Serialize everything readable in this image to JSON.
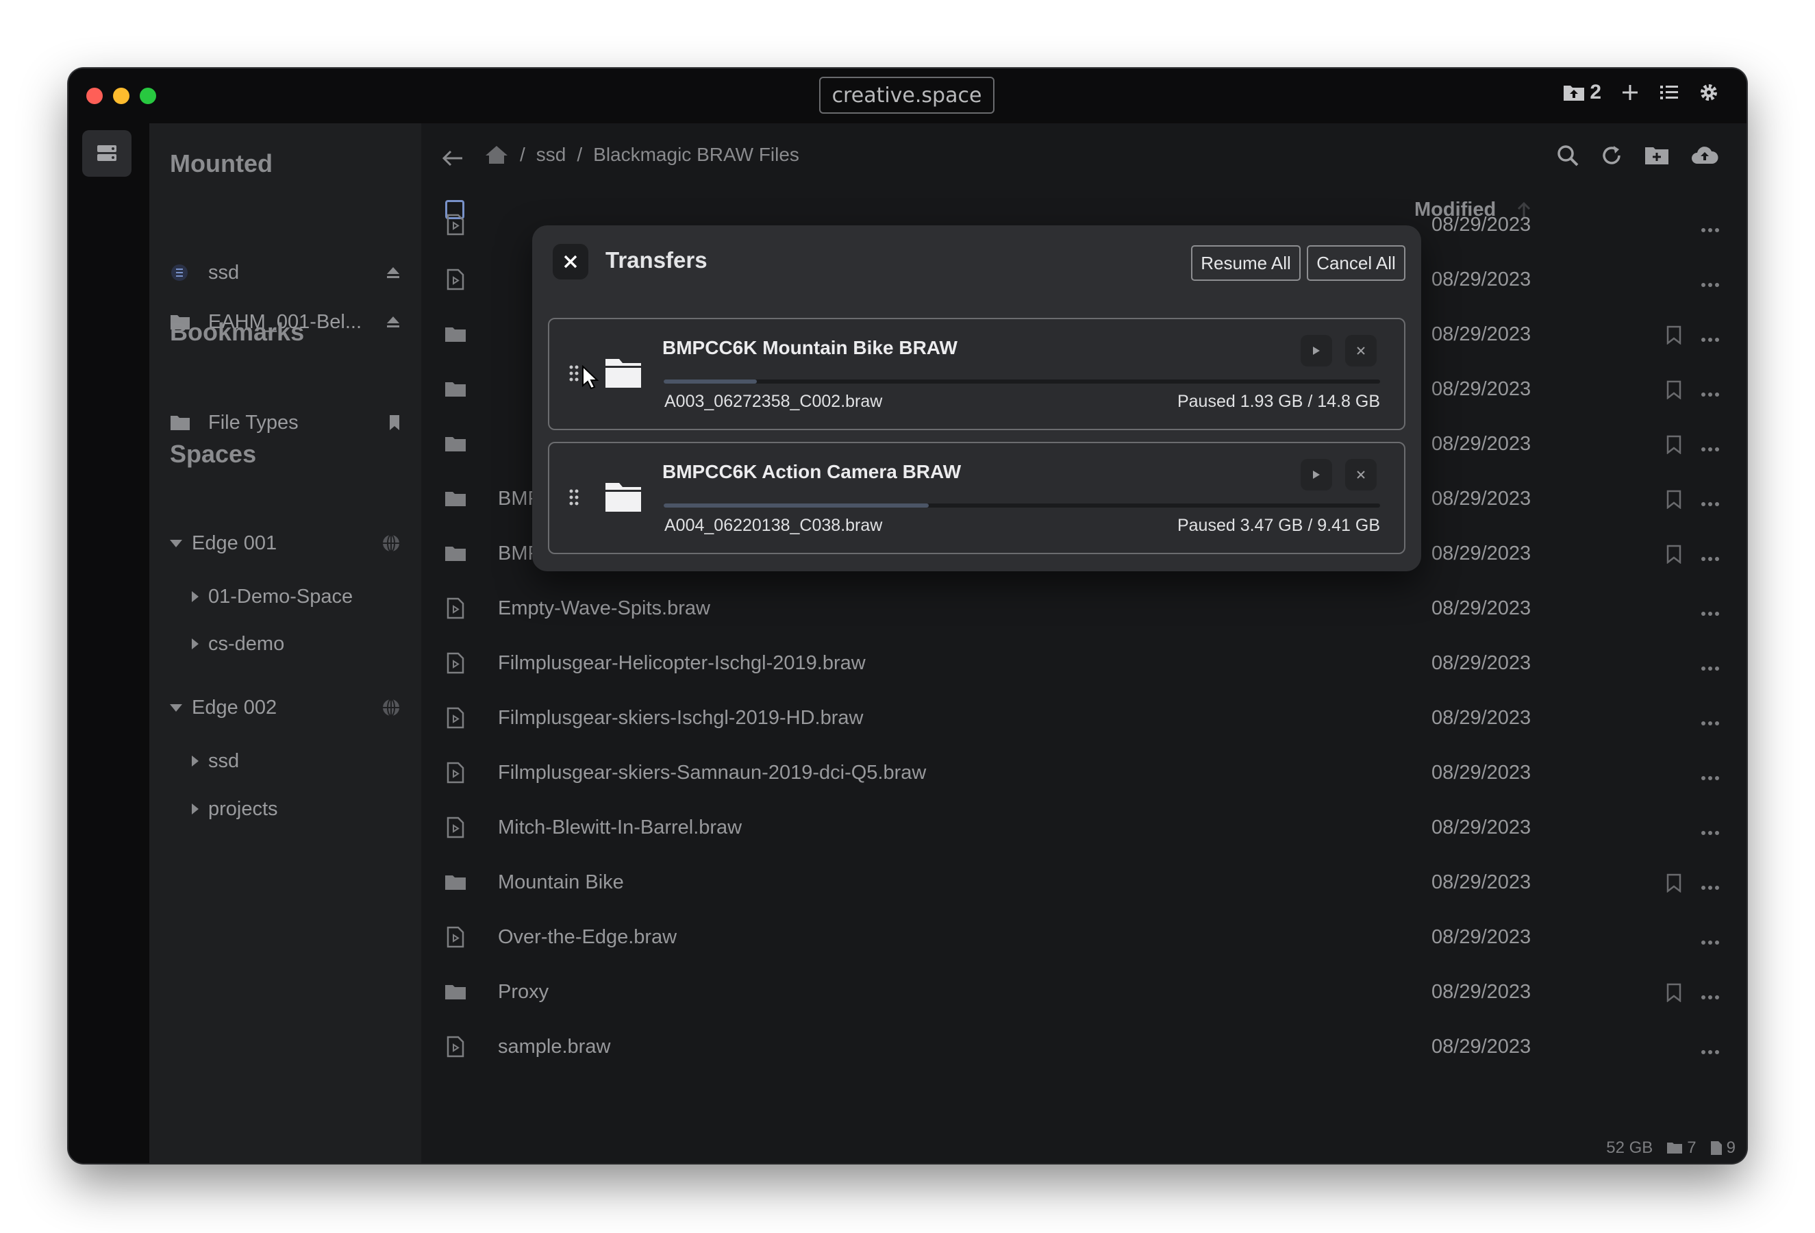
{
  "window": {
    "title": "creative.space"
  },
  "toolbar": {
    "badge_count": "2"
  },
  "sidebar": {
    "mounted_title": "Mounted",
    "mounted": [
      {
        "label": "ssd",
        "icon": "drive-icon"
      },
      {
        "label": "EAHM_001-Bel...",
        "icon": "folder-icon"
      }
    ],
    "bookmarks_title": "Bookmarks",
    "bookmarks": [
      {
        "label": "File Types"
      }
    ],
    "spaces_title": "Spaces",
    "spaces": [
      {
        "label": "Edge 001",
        "children": [
          "01-Demo-Space",
          "cs-demo"
        ]
      },
      {
        "label": "Edge 002",
        "children": [
          "ssd",
          "projects"
        ]
      }
    ]
  },
  "breadcrumb": {
    "sep1": "/",
    "part1": "ssd",
    "sep2": "/",
    "part2": "Blackmagic BRAW Files"
  },
  "columns": {
    "modified": "Modified"
  },
  "files": [
    {
      "name": "",
      "date": "08/29/2023",
      "type": "video"
    },
    {
      "name": "",
      "date": "08/29/2023",
      "type": "video"
    },
    {
      "name": "",
      "date": "08/29/2023",
      "type": "folder"
    },
    {
      "name": "",
      "date": "08/29/2023",
      "type": "folder"
    },
    {
      "name": "",
      "date": "08/29/2023",
      "type": "folder"
    },
    {
      "name": "BMPCC6K Indie Film BRAW",
      "date": "08/29/2023",
      "type": "folder"
    },
    {
      "name": "BMPCC6K Mountain Bike BRAW",
      "date": "08/29/2023",
      "type": "folder"
    },
    {
      "name": "Empty-Wave-Spits.braw",
      "date": "08/29/2023",
      "type": "video"
    },
    {
      "name": "Filmplusgear-Helicopter-Ischgl-2019.braw",
      "date": "08/29/2023",
      "type": "video"
    },
    {
      "name": "Filmplusgear-skiers-Ischgl-2019-HD.braw",
      "date": "08/29/2023",
      "type": "video"
    },
    {
      "name": "Filmplusgear-skiers-Samnaun-2019-dci-Q5.braw",
      "date": "08/29/2023",
      "type": "video"
    },
    {
      "name": "Mitch-Blewitt-In-Barrel.braw",
      "date": "08/29/2023",
      "type": "video"
    },
    {
      "name": "Mountain Bike",
      "date": "08/29/2023",
      "type": "folder"
    },
    {
      "name": "Over-the-Edge.braw",
      "date": "08/29/2023",
      "type": "video"
    },
    {
      "name": "Proxy",
      "date": "08/29/2023",
      "type": "folder"
    },
    {
      "name": "sample.braw",
      "date": "08/29/2023",
      "type": "video"
    }
  ],
  "status": {
    "size": "52 GB",
    "folders": "7",
    "files": "9"
  },
  "transfers": {
    "title": "Transfers",
    "resume_all": "Resume All",
    "cancel_all": "Cancel All",
    "items": [
      {
        "name": "BMPCC6K Mountain Bike BRAW",
        "file": "A003_06272358_C002.braw",
        "status": "Paused 1.93 GB / 14.8 GB",
        "progress": 0.13
      },
      {
        "name": "BMPCC6K Action Camera BRAW",
        "file": "A004_06220138_C038.braw",
        "status": "Paused 3.47 GB / 9.41 GB",
        "progress": 0.37
      }
    ]
  },
  "colors": {
    "window_bg": "#17181a",
    "sidebar_bg": "#1e1f21",
    "modal_bg": "#2e2f32",
    "close_red": "#fe5f57",
    "min_yellow": "#febc2e",
    "max_green": "#28c840",
    "accent_blue": "#7891c9"
  }
}
